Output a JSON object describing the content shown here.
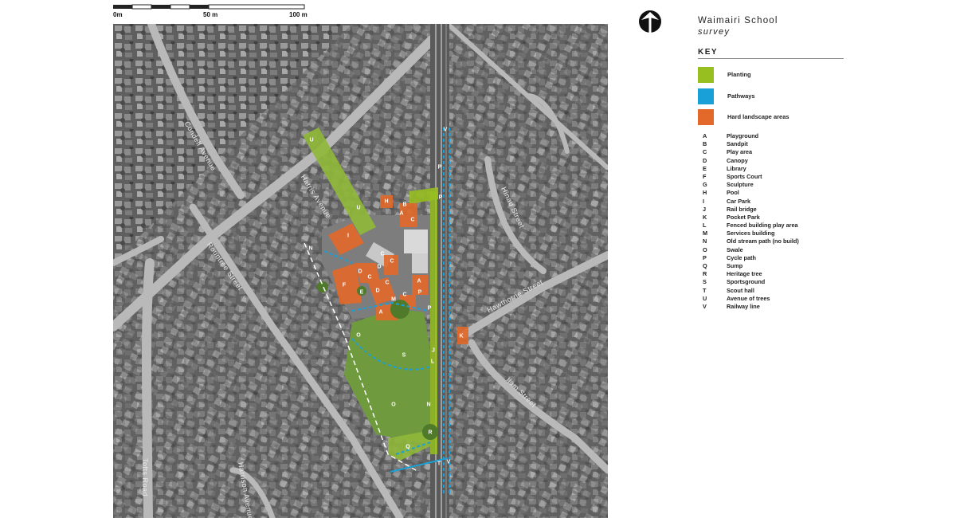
{
  "scale": {
    "labels": [
      "0m",
      "50 m",
      "100 m"
    ]
  },
  "title": "Waimairi School",
  "subtitle": "survey",
  "key": {
    "heading": "KEY",
    "swatches": [
      {
        "label": "Planting",
        "color": "#97bf20"
      },
      {
        "label": "Pathways",
        "color": "#1aa0d8"
      },
      {
        "label": "Hard landscape areas",
        "color": "#e2692a"
      }
    ],
    "items": [
      {
        "code": "A",
        "name": "Playground"
      },
      {
        "code": "B",
        "name": "Sandpit"
      },
      {
        "code": "C",
        "name": "Play area"
      },
      {
        "code": "D",
        "name": "Canopy"
      },
      {
        "code": "E",
        "name": "Library"
      },
      {
        "code": "F",
        "name": "Sports Court"
      },
      {
        "code": "G",
        "name": "Sculpture"
      },
      {
        "code": "H",
        "name": "Pool"
      },
      {
        "code": "I",
        "name": "Car Park"
      },
      {
        "code": "J",
        "name": "Rail bridge"
      },
      {
        "code": "K",
        "name": "Pocket Park"
      },
      {
        "code": "L",
        "name": "Fenced building play area"
      },
      {
        "code": "M",
        "name": "Services building"
      },
      {
        "code": "N",
        "name": "Old stream path (no build)"
      },
      {
        "code": "O",
        "name": "Swale"
      },
      {
        "code": "P",
        "name": "Cycle path"
      },
      {
        "code": "Q",
        "name": "Sump"
      },
      {
        "code": "R",
        "name": "Heritage tree"
      },
      {
        "code": "S",
        "name": "Sportsground"
      },
      {
        "code": "T",
        "name": "Scout hall"
      },
      {
        "code": "U",
        "name": "Avenue of trees"
      },
      {
        "code": "V",
        "name": "Railway line"
      }
    ]
  },
  "map": {
    "road_labels": [
      "Condell Avenue",
      "Harris Avenue",
      "Rountree Street",
      "Hawthorne Street",
      "Hinau Street",
      "Ilam Street",
      "Tofts Road",
      "Harrison Avenue"
    ]
  }
}
